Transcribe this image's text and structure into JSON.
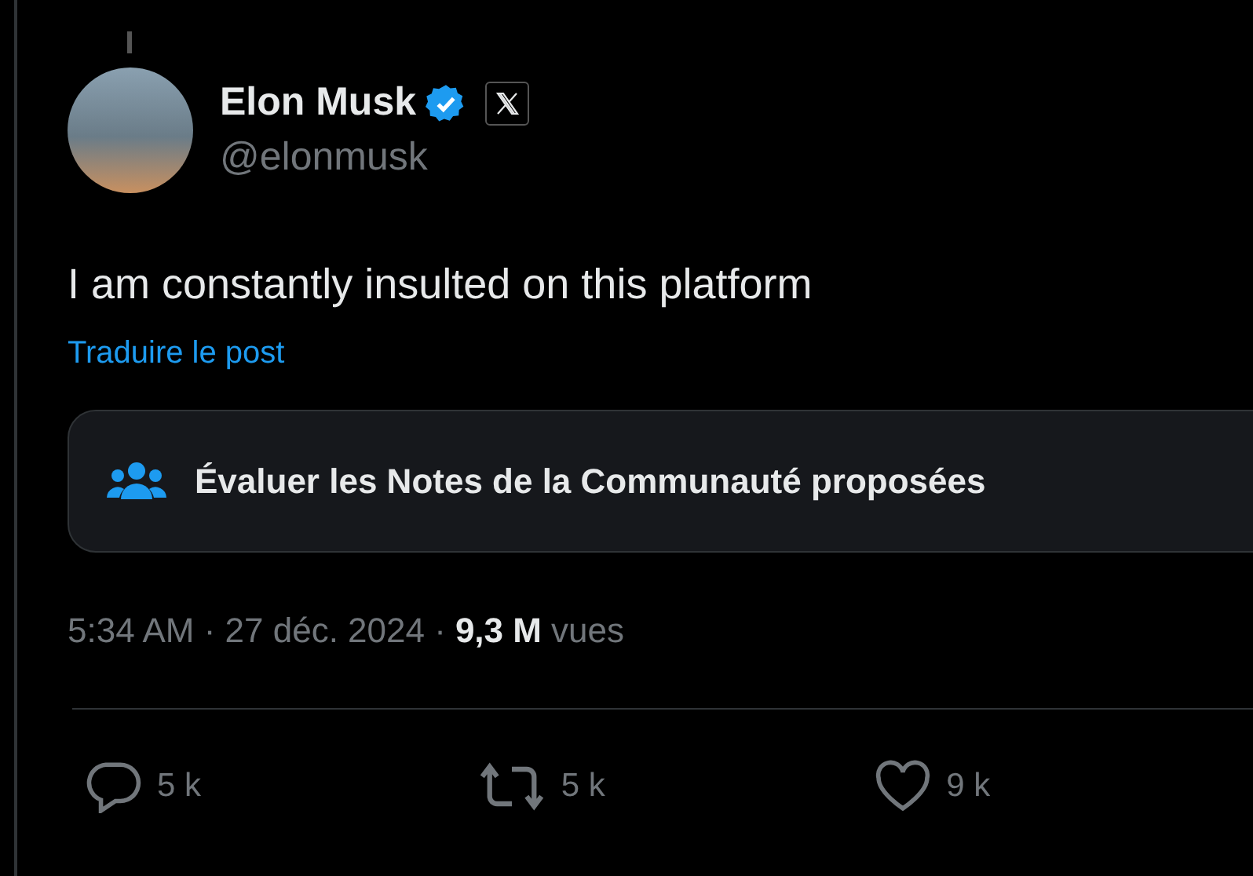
{
  "author": {
    "name": "Elon Musk",
    "verified": true,
    "handle": "@elonmusk"
  },
  "post": {
    "text": "I am constantly insulted on this platform",
    "translate_link": "Traduire le post"
  },
  "community_notes": {
    "label": "Évaluer les Notes de la Communauté proposées"
  },
  "meta": {
    "timestamp": "5:34 AM · 27 déc. 2024 ·",
    "views_count": "9,3 M",
    "views_label": "vues"
  },
  "actions": [
    {
      "kind": "reply",
      "count": "5 k"
    },
    {
      "kind": "repost",
      "count": "5 k"
    },
    {
      "kind": "like",
      "count": "9 k"
    }
  ]
}
